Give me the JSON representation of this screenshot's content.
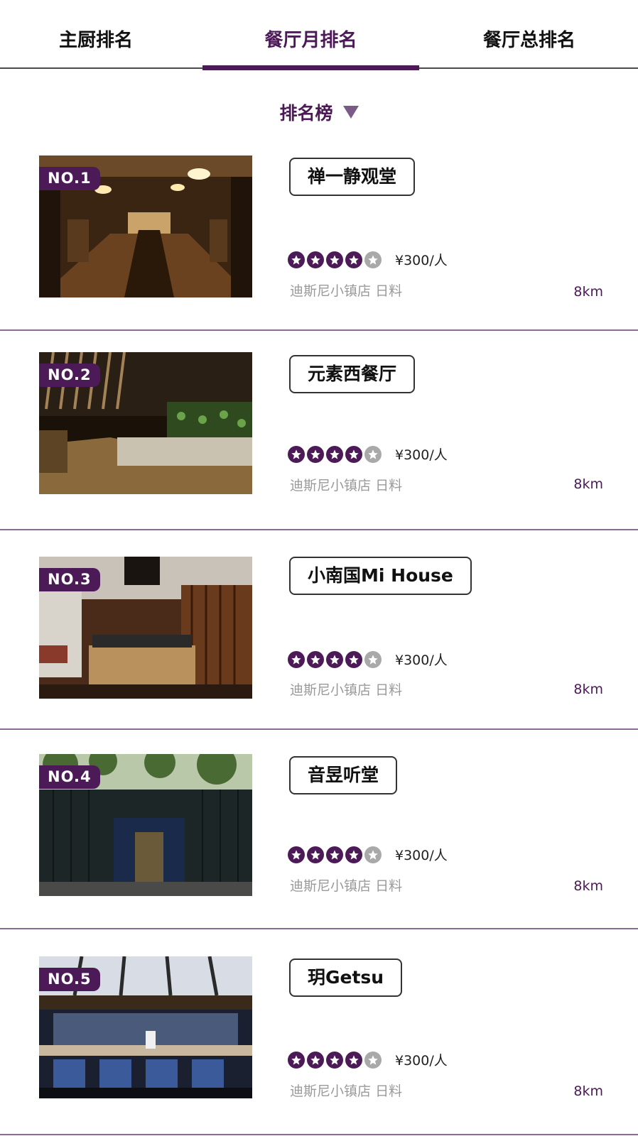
{
  "tabs": [
    {
      "label": "主厨排名",
      "active": false
    },
    {
      "label": "餐厅月排名",
      "active": true
    },
    {
      "label": "餐厅总排名",
      "active": false
    }
  ],
  "sort": {
    "label": "排名榜"
  },
  "colors": {
    "accent": "#4b1a57",
    "star_off": "#a9a9a9",
    "meta_text": "#9a9a9a"
  },
  "restaurants": [
    {
      "rank": "NO.1",
      "name": "禅一静观堂",
      "rating": 4,
      "max_rating": 5,
      "price": "¥300/人",
      "location": "迪斯尼小镇店",
      "cuisine": "日料",
      "distance": "8km"
    },
    {
      "rank": "NO.2",
      "name": "元素西餐厅",
      "rating": 4,
      "max_rating": 5,
      "price": "¥300/人",
      "location": "迪斯尼小镇店",
      "cuisine": "日料",
      "distance": "8km"
    },
    {
      "rank": "NO.3",
      "name": "小南国Mi House",
      "rating": 4,
      "max_rating": 5,
      "price": "¥300/人",
      "location": "迪斯尼小镇店",
      "cuisine": "日料",
      "distance": "8km"
    },
    {
      "rank": "NO.4",
      "name": "音昱听堂",
      "rating": 4,
      "max_rating": 5,
      "price": "¥300/人",
      "location": "迪斯尼小镇店",
      "cuisine": "日料",
      "distance": "8km"
    },
    {
      "rank": "NO.5",
      "name": "玥Getsu",
      "rating": 4,
      "max_rating": 5,
      "price": "¥300/人",
      "location": "迪斯尼小镇店",
      "cuisine": "日料",
      "distance": "8km"
    }
  ]
}
